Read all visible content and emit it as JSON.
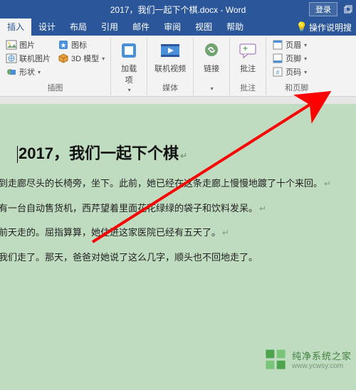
{
  "colors": {
    "word_blue": "#2b579a",
    "ribbon_bg": "#f3f3f3",
    "page_green": "#c0dcc0",
    "arrow_red": "#ff0000"
  },
  "titlebar": {
    "document_title": "2017，我们一起下个棋.docx - Word",
    "login_label": "登录"
  },
  "tabs": {
    "items": [
      {
        "label": "插入",
        "active": true
      },
      {
        "label": "设计"
      },
      {
        "label": "布局"
      },
      {
        "label": "引用"
      },
      {
        "label": "邮件"
      },
      {
        "label": "审阅"
      },
      {
        "label": "视图"
      },
      {
        "label": "帮助"
      }
    ],
    "tell_me": "操作说明搜"
  },
  "ribbon": {
    "group_illustrations": {
      "picture": "图片",
      "online_picture": "联机图片",
      "shapes": "形状",
      "icons": "图标",
      "model_3d": "3D 模型",
      "label": "插图"
    },
    "group_addins": {
      "addins": "加载\n项",
      "label": ""
    },
    "group_media": {
      "online_video": "联机视频",
      "label": "媒体"
    },
    "group_links": {
      "link": "链接",
      "label": ""
    },
    "group_comments": {
      "comment": "批注",
      "label": "批注"
    },
    "group_headerfooter": {
      "header": "页眉",
      "footer": "页脚",
      "page_number": "页码",
      "label": "和页脚"
    }
  },
  "document": {
    "title": "2017，我们一起下个棋",
    "paragraphs": [
      "到走廊尽头的长椅旁，坐下。此前，她已经在这条走廊上慢慢地踱了十个来回。",
      "有一台自动售货机，西芹望着里面花花绿绿的袋子和饮料发呆。",
      "前天走的。屈指算算，她住进这家医院已经有五天了。",
      "我们走了。那天，爸爸对她说了这么几字，顺头也不回地走了。"
    ]
  },
  "watermark": {
    "brand": "纯净系统之家",
    "url": "www.ycwsy.com"
  }
}
